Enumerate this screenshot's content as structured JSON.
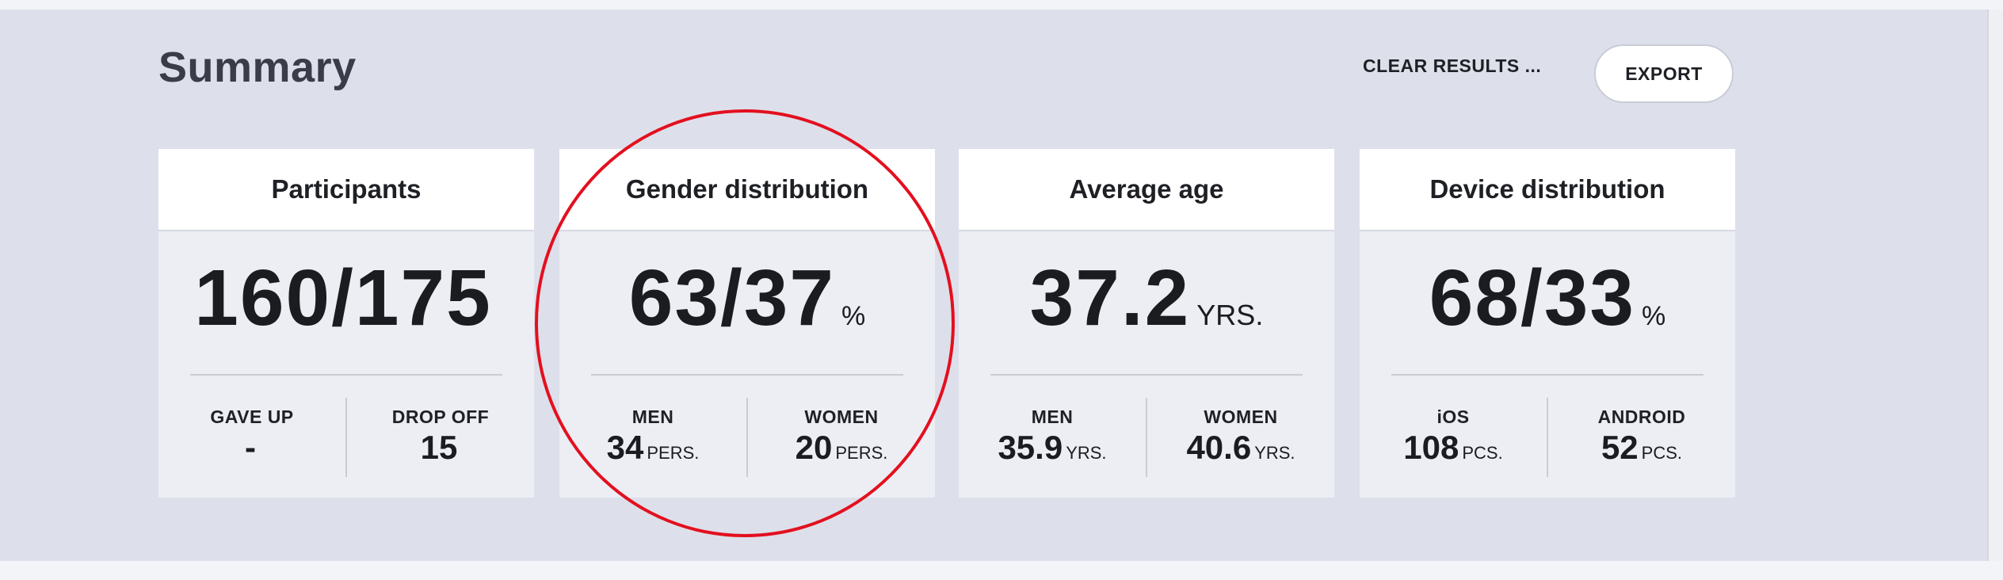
{
  "header": {
    "title": "Summary",
    "clear_label": "CLEAR RESULTS ...",
    "export_label": "EXPORT"
  },
  "cards": [
    {
      "title": "Participants",
      "value": "160/175",
      "unit": "",
      "left": {
        "label": "GAVE UP",
        "value": "-",
        "unit": ""
      },
      "right": {
        "label": "DROP OFF",
        "value": "15",
        "unit": ""
      }
    },
    {
      "title": "Gender distribution",
      "value": "63/37",
      "unit": "%",
      "left": {
        "label": "MEN",
        "value": "34",
        "unit": "PERS."
      },
      "right": {
        "label": "WOMEN",
        "value": "20",
        "unit": "PERS."
      }
    },
    {
      "title": "Average age",
      "value": "37.2",
      "unit": "YRS.",
      "left": {
        "label": "MEN",
        "value": "35.9",
        "unit": "YRS."
      },
      "right": {
        "label": "WOMEN",
        "value": "40.6",
        "unit": "YRS."
      }
    },
    {
      "title": "Device distribution",
      "value": "68/33",
      "unit": "%",
      "left": {
        "label": "iOS",
        "value": "108",
        "unit": "PCS."
      },
      "right": {
        "label": "ANDROID",
        "value": "52",
        "unit": "PCS."
      }
    }
  ],
  "colors": {
    "panel": "#dde0ea",
    "highlight": "#e3101f"
  }
}
